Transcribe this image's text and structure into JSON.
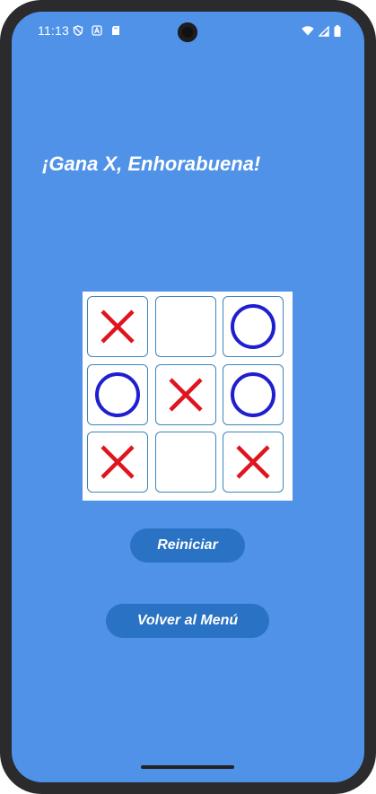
{
  "status_bar": {
    "time": "11:13",
    "left_icons": [
      "shield-icon",
      "a-badge-icon",
      "sd-card-icon"
    ],
    "right_icons": [
      "wifi-icon",
      "signal-icon",
      "battery-icon"
    ]
  },
  "game": {
    "result_message": "¡Gana X, Enhorabuena!",
    "board": [
      [
        "X",
        "",
        "O"
      ],
      [
        "O",
        "X",
        "O"
      ],
      [
        "X",
        "",
        "X"
      ]
    ],
    "colors": {
      "x": "#e0141e",
      "o": "#1f1fcf",
      "cell_border": "#3e86b8"
    }
  },
  "buttons": {
    "restart_label": "Reiniciar",
    "menu_label": "Volver al Menú"
  }
}
